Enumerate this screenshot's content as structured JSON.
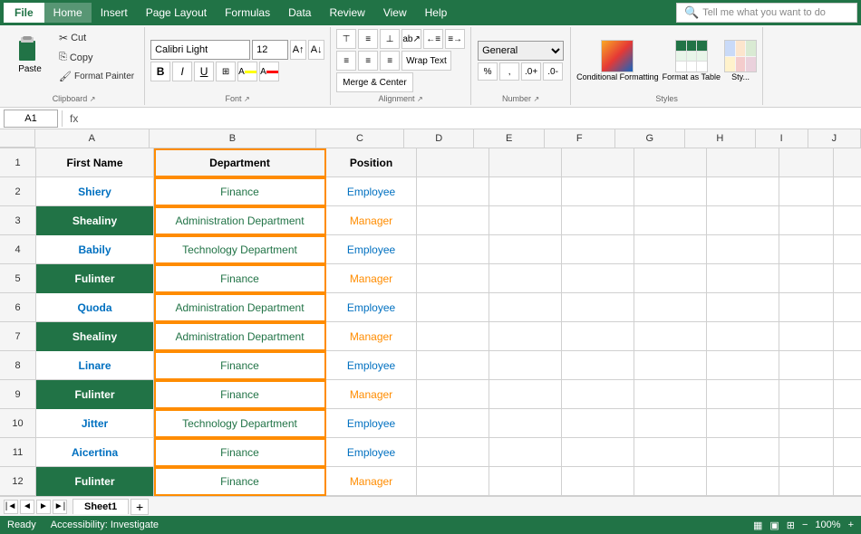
{
  "menubar": {
    "file": "File",
    "items": [
      "Home",
      "Insert",
      "Page Layout",
      "Formulas",
      "Data",
      "Review",
      "View",
      "Help"
    ]
  },
  "toolbar": {
    "clipboard": {
      "paste": "Paste",
      "cut": "✂ Cut",
      "copy": "Copy",
      "format_painter": "Format Painter"
    },
    "font": {
      "name": "Calibri Light",
      "size": "12",
      "bold": "B",
      "italic": "I",
      "underline": "U"
    },
    "alignment": {
      "wrap_text": "Wrap Text",
      "merge_center": "Merge & Center"
    },
    "number": {
      "format": "General"
    },
    "styles": {
      "conditional": "Conditional Formatting",
      "format_table": "Format as Table",
      "cell_styles": "Sty..."
    },
    "tellme": "Tell me what you want to do"
  },
  "formula_bar": {
    "cell_ref": "A1",
    "formula": ""
  },
  "columns": {
    "headers": [
      "A",
      "B",
      "C",
      "D",
      "E",
      "F",
      "G",
      "H",
      "I",
      "J"
    ]
  },
  "rows": {
    "numbers": [
      "1",
      "2",
      "3",
      "4",
      "5",
      "6",
      "7",
      "8",
      "9",
      "10",
      "11",
      "12"
    ]
  },
  "data": {
    "header": {
      "col_a": "First Name",
      "col_b": "Department",
      "col_c": "Position"
    },
    "rows": [
      {
        "id": 2,
        "name": "Shiery",
        "dept": "Finance",
        "pos": "Employee",
        "name_green": false
      },
      {
        "id": 3,
        "name": "Shealiny",
        "dept": "Administration Department",
        "pos": "Manager",
        "name_green": true
      },
      {
        "id": 4,
        "name": "Babily",
        "dept": "Technology Department",
        "pos": "Employee",
        "name_green": false
      },
      {
        "id": 5,
        "name": "Fulinter",
        "dept": "Finance",
        "pos": "Manager",
        "name_green": true
      },
      {
        "id": 6,
        "name": "Quoda",
        "dept": "Administration Department",
        "pos": "Employee",
        "name_green": false
      },
      {
        "id": 7,
        "name": "Shealiny",
        "dept": "Administration Department",
        "pos": "Manager",
        "name_green": true
      },
      {
        "id": 8,
        "name": "Linare",
        "dept": "Finance",
        "pos": "Employee",
        "name_green": false
      },
      {
        "id": 9,
        "name": "Fulinter",
        "dept": "Finance",
        "pos": "Manager",
        "name_green": true
      },
      {
        "id": 10,
        "name": "Jitter",
        "dept": "Technology Department",
        "pos": "Employee",
        "name_green": false
      },
      {
        "id": 11,
        "name": "Aicertina",
        "dept": "Finance",
        "pos": "Employee",
        "name_green": false
      },
      {
        "id": 12,
        "name": "Fulinter",
        "dept": "Finance",
        "pos": "Manager",
        "name_green": true
      }
    ]
  },
  "sheet_tab": "Sheet1",
  "status": {
    "ready": "Ready",
    "accessibility": "Accessibility: Investigate"
  }
}
